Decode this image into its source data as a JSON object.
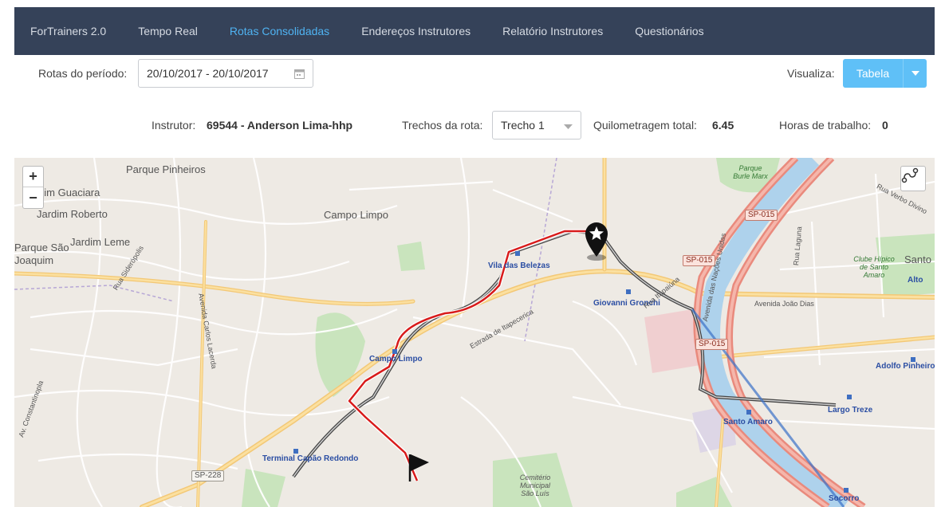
{
  "nav": {
    "brand": "ForTrainers 2.0",
    "items": [
      "Tempo Real",
      "Rotas Consolidadas",
      "Endereços Instrutores",
      "Relatório Instrutores",
      "Questionários"
    ],
    "active": "Rotas Consolidadas",
    "active_color": "#4fb3f2",
    "bar_color": "#354259"
  },
  "filters": {
    "period_label": "Rotas do período:",
    "date_range": "20/10/2017 - 20/10/2017",
    "visualize_label": "Visualiza:",
    "view_mode": "Tabela"
  },
  "info": {
    "instructor_label": "Instrutor:",
    "instructor_value": "69544 - Anderson Lima-hhp",
    "segments_label": "Trechos da rota:",
    "segment_selected": "Trecho 1",
    "mileage_label": "Quilometragem total:",
    "mileage_value": "6.45",
    "hours_label": "Horas de trabalho:",
    "hours_value": "0"
  },
  "map": {
    "zoom_in": "+",
    "zoom_out": "−",
    "route_color": "#d81b1b",
    "places": {
      "parque_pinheiros": "Parque Pinheiros",
      "jardim_guaciara": "Jardim Guaciara",
      "jardim_roberto": "Jardim Roberto",
      "jardim_leme": "Jardim Leme",
      "parque_sao": "Parque São",
      "joaquim": "Joaquim",
      "campo_limpo": "Campo Limpo",
      "santo": "Santo",
      "alto": "Alto"
    },
    "stations": {
      "vila_das_belezas": "Vila das Belezas",
      "giovanni_gronchi": "Giovanni Gronchi",
      "campo_limpo": "Campo Limpo",
      "terminal_capao_redondo": "Terminal Capão Redondo",
      "santo_amaro": "Santo Amaro",
      "largo_treze": "Largo Treze",
      "adolfo_pinheiro": "Adolfo Pinheiro",
      "socorro": "Socorro"
    },
    "shields": {
      "sp015_a": "SP-015",
      "sp015_b": "SP-015",
      "sp015_c": "SP-015",
      "sp228": "SP-228"
    },
    "streets": {
      "estrada_itapecerica": "Estrada de Itapecerica",
      "rua_itapaiuna": "Rua Itapaiúna",
      "avenida_joao_dias": "Avenida João Dias",
      "avenida_nacoes_unidas": "Avenida das Nações Unidas",
      "avenida_carlos_lacerda": "Avenida Carlos Lacerda",
      "rua_siderópolis": "Rua Siderópolis",
      "rua_laguna": "Rua Laguna",
      "rua_verbo_divino": "Rua Verbo Divino",
      "avenida_constantinopla": "Av. Constantinopla"
    },
    "parks": {
      "parque_burle_marx": "Parque Burle Marx",
      "clube_hipico": "Clube Hípico de Santo Amaro",
      "cemiterio": "Cemitério Municipal São Luís"
    }
  }
}
